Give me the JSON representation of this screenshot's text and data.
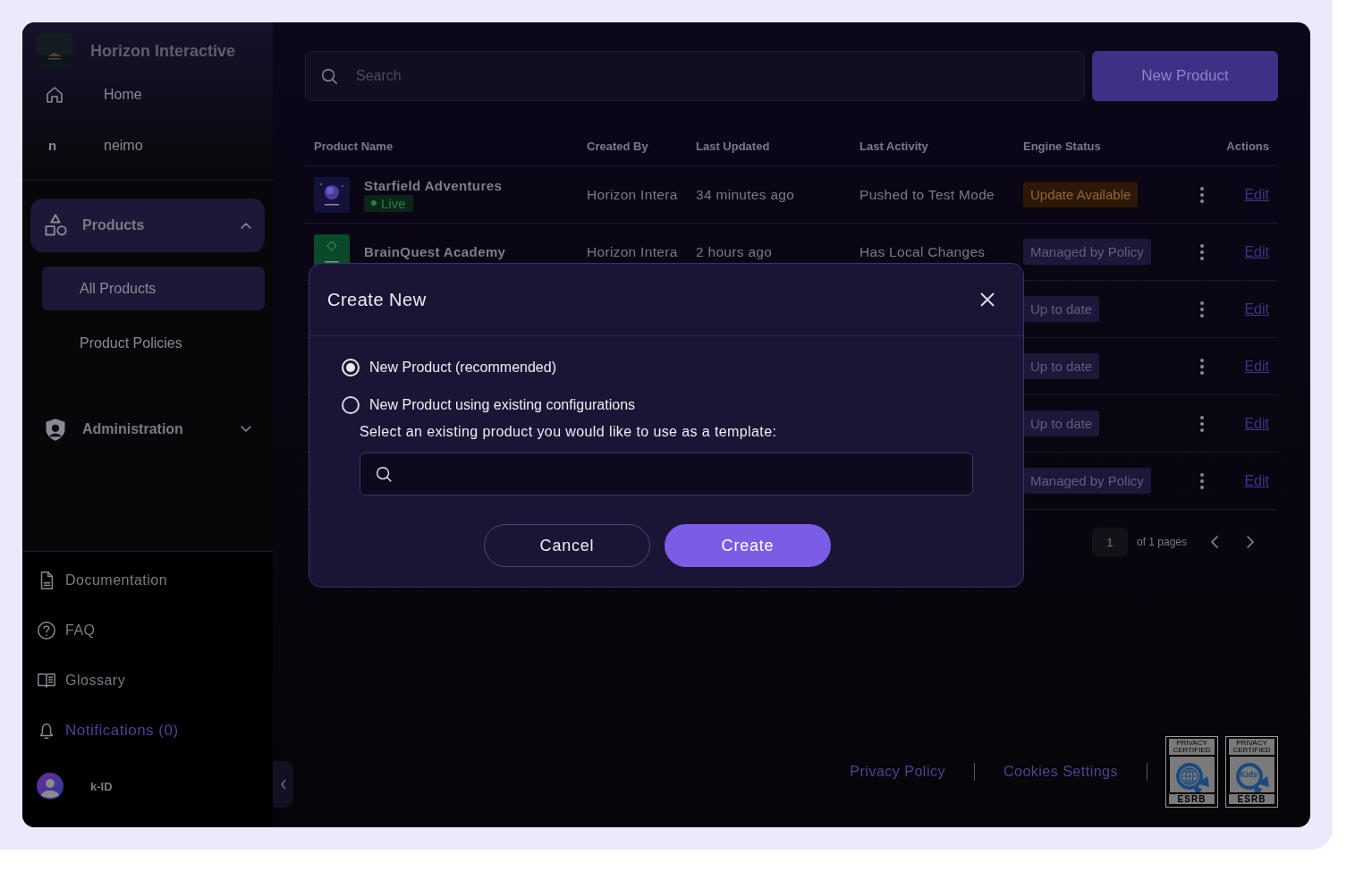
{
  "sidebar": {
    "brand": "Horizon Interactive",
    "top_items": [
      {
        "kind": "home",
        "label": "Home"
      },
      {
        "kind": "initial",
        "initial": "n",
        "label": "neimo"
      }
    ],
    "nav": [
      {
        "label": "Products",
        "expanded": true,
        "children": [
          {
            "label": "All Products",
            "selected": true
          },
          {
            "label": "Product Policies",
            "selected": false
          }
        ]
      },
      {
        "label": "Administration",
        "expanded": false
      }
    ],
    "links": [
      {
        "label": "Documentation",
        "accent": false
      },
      {
        "label": "FAQ",
        "accent": false
      },
      {
        "label": "Glossary",
        "accent": false
      },
      {
        "label": "Notifications (0)",
        "accent": true
      }
    ],
    "user": {
      "name": "k-ID"
    }
  },
  "search": {
    "placeholder": "Search"
  },
  "new_button": "New Product",
  "table": {
    "columns": [
      "Product Name",
      "Created By",
      "Last Updated",
      "Last Activity",
      "Engine Status",
      "Actions"
    ],
    "rows": [
      {
        "name": "Starfield Adventures",
        "badge": "Live",
        "created_by": "Horizon Intera",
        "last_updated": "34 minutes ago",
        "last_activity": "Pushed to Test Mode",
        "engine_status": {
          "label": "Update Available",
          "kind": "update"
        },
        "action": "Edit"
      },
      {
        "name": "BrainQuest Academy",
        "created_by": "Horizon Intera",
        "last_updated": "2 hours ago",
        "last_activity": "Has Local Changes",
        "engine_status": {
          "label": "Managed by Policy",
          "kind": "policy"
        },
        "action": "Edit"
      },
      {
        "engine_status": {
          "label": "Up to date",
          "kind": "ok"
        },
        "action": "Edit"
      },
      {
        "engine_status": {
          "label": "Up to date",
          "kind": "ok"
        },
        "action": "Edit"
      },
      {
        "engine_status": {
          "label": "Up to date",
          "kind": "ok"
        },
        "action": "Edit"
      },
      {
        "engine_status": {
          "label": "Managed by Policy",
          "kind": "policy"
        },
        "action": "Edit"
      }
    ]
  },
  "pagination": {
    "page": "1",
    "of_pages": "of 1 pages"
  },
  "footer": {
    "links": [
      "Privacy Policy",
      "Cookies Settings"
    ],
    "seals": [
      {
        "kind": "globe",
        "top": "PRIVACY CERTIFIED",
        "bottom": "ESRB"
      },
      {
        "kind": "kids",
        "top": "PRIVACY CERTIFIED",
        "center": "Kids",
        "bottom": "ESRB"
      }
    ]
  },
  "modal": {
    "title": "Create New",
    "options": [
      {
        "label": "New Product (recommended)",
        "selected": true
      },
      {
        "label": "New Product using existing configurations",
        "selected": false
      }
    ],
    "template_prompt": "Select an existing product you would like to use as a template:",
    "buttons": [
      {
        "label": "Cancel",
        "kind": "secondary"
      },
      {
        "label": "Create",
        "kind": "primary"
      }
    ]
  }
}
